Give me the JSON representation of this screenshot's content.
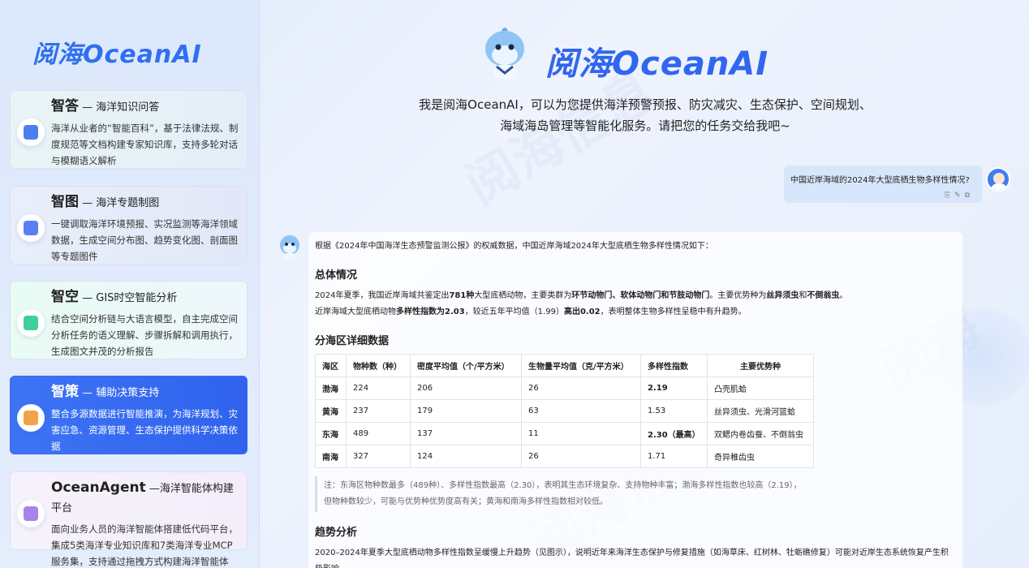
{
  "brand": "阅海OceanAI",
  "sidebar": {
    "cards": [
      {
        "title": "智答",
        "subtitle": " — 海洋知识问答",
        "desc": "海洋从业者的“智能百科”，基于法律法规、制度规范等文档构建专家知识库，支持多轮对话与模糊语义解析",
        "icon": "question-answer-icon",
        "color": "#4a7ff0"
      },
      {
        "title": "智图",
        "subtitle": " — 海洋专题制图",
        "desc": "一键调取海洋环境预报、实况监测等海洋领域数据，生成空间分布图、趋势变化图、剖面图等专题图件",
        "icon": "map-icon",
        "color": "#5b7ff3"
      },
      {
        "title": "智空",
        "subtitle": " — GIS时空智能分析",
        "desc": "结合空间分析链与大语言模型，自主完成空间分析任务的语义理解、步骤拆解和调用执行，生成图文并茂的分析报告",
        "icon": "analysis-icon",
        "color": "#3fcf9a"
      },
      {
        "title": "智策",
        "subtitle": " — 辅助决策支持",
        "desc": "整合多源数据进行智能推演，为海洋规划、灾害应急、资源管理、生态保护提供科学决策依据",
        "icon": "decision-icon",
        "color": "#f2a247"
      },
      {
        "title": "OceanAgent",
        "subtitle": " —海洋智能体构建平台",
        "desc": "面向业务人员的海洋智能体搭建低代码平台，集成5类海洋专业知识库和7类海洋专业MCP服务集，支持通过拖拽方式构建海洋智能体",
        "icon": "agent-icon",
        "color": "#a585e8"
      }
    ]
  },
  "hero": {
    "title": "阅海OceanAI",
    "intro_line1": "我是阅海OceanAI，可以为您提供海洋预警预报、防灾减灾、生态保护、空间规划、",
    "intro_line2": "海域海岛管理等智能化服务。请把您的任务交给我吧~"
  },
  "user_message": {
    "text": "中国近岸海域的2024年大型底栖生物多样性情况?",
    "actions": "⎘✎⧉"
  },
  "answer": {
    "lead": "根据《2024年中国海洋生态预警监测公报》的权威数据，中国近岸海域2024年大型底栖生物多样性情况如下：",
    "h_overall": "总体情况",
    "overall_p1_a": "2024年夏季，我国近岸海域共鉴定出",
    "overall_p1_b": "781种",
    "overall_p1_c": "大型底栖动物，主要类群为",
    "overall_p1_d": "环节动物门、软体动物门和节肢动物门",
    "overall_p1_e": "。主要优势种为",
    "overall_p1_f": "丝异须虫",
    "overall_p1_g": "和",
    "overall_p1_h": "不倒翁虫",
    "overall_p1_i": "。",
    "overall_p2_a": "近岸海域大型底栖动物",
    "overall_p2_b": "多样性指数为2.03",
    "overall_p2_c": "，较近五年平均值（1.99）",
    "overall_p2_d": "高出0.02",
    "overall_p2_e": "，表明整体生物多样性呈稳中有升趋势。",
    "h_table": "分海区详细数据",
    "table": {
      "headers": [
        "海区",
        "物种数（种）",
        "密度平均值（个/平方米）",
        "生物量平均值（克/平方米）",
        "多样性指数",
        "主要优势种"
      ],
      "rows": [
        [
          "渤海",
          "224",
          "206",
          "26",
          "2.19",
          "凸壳肌蛤"
        ],
        [
          "黄海",
          "237",
          "179",
          "63",
          "1.53",
          "丝异须虫、光滑河篮蛤"
        ],
        [
          "东海",
          "489",
          "137",
          "11",
          "2.30（最高）",
          "双鳃内卷齿蚕、不倒翁虫"
        ],
        [
          "南海",
          "327",
          "124",
          "26",
          "1.71",
          "奇异稚齿虫"
        ]
      ]
    },
    "note": "注：东海区物种数最多（489种）、多样性指数最高（2.30），表明其生态环境复杂、支持物种丰富；渤海多样性指数也较高（2.19），但物种数较少，可能与优势种优势度高有关；黄海和南海多样性指数相对较低。",
    "h_trend": "趋势分析",
    "trend": "2020–2024年夏季大型底栖动物多样性指数呈缓慢上升趋势（见图示），说明近年来海洋生态保护与修复措施（如海草床、红树林、牡蛎礁修复）可能对近岸生态系统恢复产生积极影响。"
  }
}
